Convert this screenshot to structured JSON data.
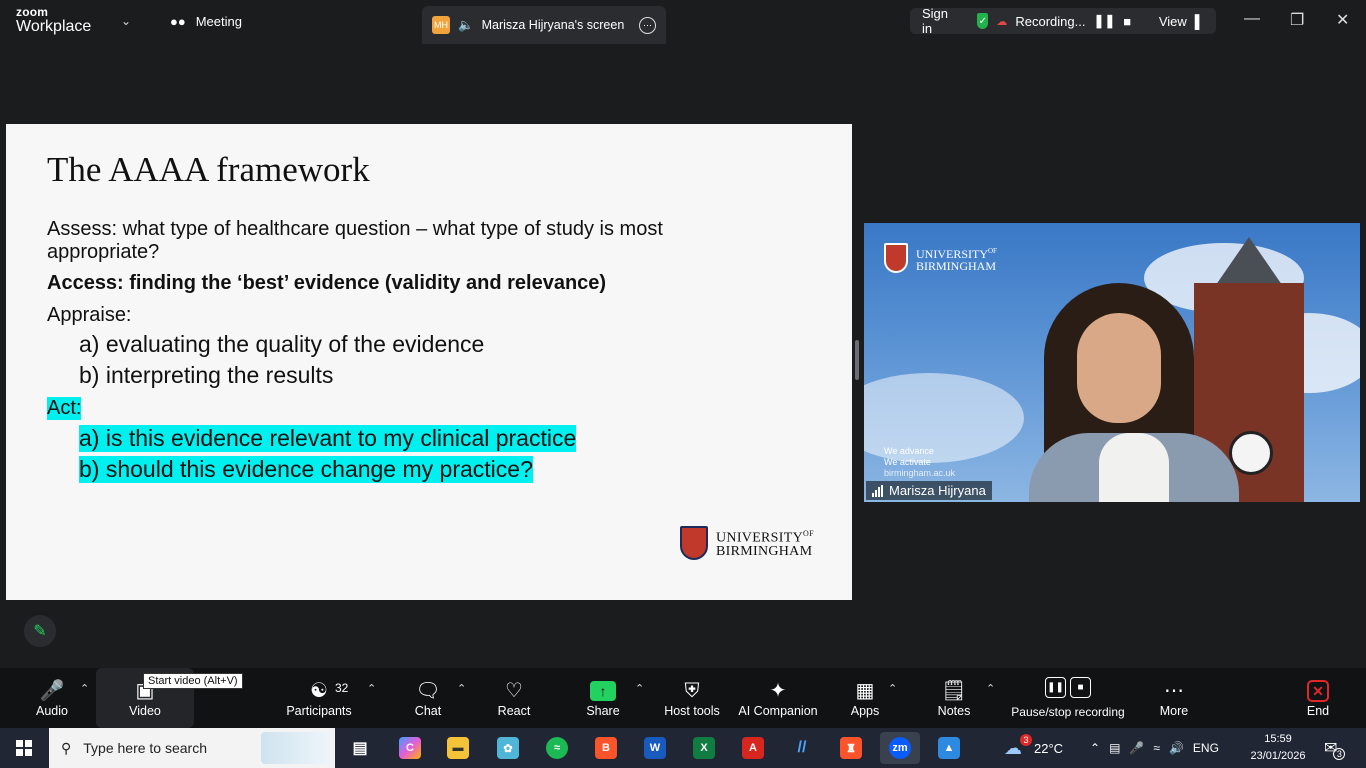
{
  "titlebar": {
    "brand_small": "zoom",
    "brand_large": "Workplace",
    "meeting_label": "Meeting",
    "screen_tab": {
      "initials": "MH",
      "label": "Marisza Hijryana's screen"
    },
    "sign_in": "Sign in",
    "recording_label": "Recording...",
    "view_label": "View"
  },
  "slide": {
    "title": "The AAAA framework",
    "assess": "Assess: what type of healthcare question – what type of study is most appropriate?",
    "access": "Access: finding the ‘best’ evidence (validity and relevance)",
    "appraise": "Appraise:",
    "appraise_a": "a) evaluating the quality of the evidence",
    "appraise_b": "b) interpreting the results",
    "act": "Act:",
    "act_a": "a) is this evidence relevant to my clinical practice",
    "act_b": "b) should this evidence change my practice?",
    "logo_line1": "UNIVERSITY",
    "logo_of": "OF",
    "logo_line2": "BIRMINGHAM",
    "highlight_color": "#00f0f0"
  },
  "video": {
    "logo_line1": "UNIVERSITY",
    "logo_of": "OF",
    "logo_line2": "BIRMINGHAM",
    "advance": "We advance",
    "activate": "We activate",
    "url": "birmingham.ac.uk",
    "participant_name": "Marisza Hijryana"
  },
  "toolbar": {
    "audio": "Audio",
    "video": "Video",
    "tooltip": "Start video (Alt+V)",
    "participants": "Participants",
    "participants_count": "32",
    "chat": "Chat",
    "react": "React",
    "share": "Share",
    "host_tools": "Host tools",
    "ai_companion": "AI Companion",
    "apps": "Apps",
    "notes": "Notes",
    "pause_stop": "Pause/stop recording",
    "more": "More",
    "end": "End"
  },
  "taskbar": {
    "search_placeholder": "Type here to search",
    "weather_badge": "3",
    "temperature": "22°C",
    "language": "ENG",
    "time": "15:59",
    "date": "23/01/2026",
    "notification_count": "3"
  },
  "colors": {
    "accent_green": "#23d160",
    "end_red": "#e02828",
    "zoom_blue": "#0b5cff"
  }
}
